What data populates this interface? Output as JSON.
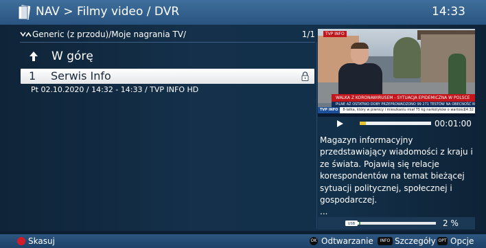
{
  "header": {
    "title": "NAV > Filmy video / DVR",
    "clock": "14:33",
    "icon": "folder-icon"
  },
  "list": {
    "path": "Generic (z przodu)/Moje nagrania TV/",
    "page": "1/1",
    "up_label": "W górę",
    "items": [
      {
        "number": "1",
        "name": "Serwis Info",
        "meta": "Pt 02.10.2020 / 14:32 - 14:33 / TVP INFO HD",
        "locked": true
      }
    ]
  },
  "preview": {
    "channel_tag": "TVP INFO",
    "banner": "WALKA Z KORONAWIRUSEM - SYTUACJA EPIDEMICZNA W POLSCE",
    "ticker_top": "PILNE   AŻ OSTATNIO DOBY PRZEPROWADZONO 99 271 TESTÓW NA OBECNOŚĆ KORONAWIRUSA",
    "ticker": "8-latka, który w piwnicy i mieszkaniu miał 75 kg narkotyków o wartości",
    "ticker_logo": "TVP INFO",
    "ticker_time": "14:32"
  },
  "playback": {
    "time": "00:01:00",
    "progress": 0.09,
    "progress_color": "#e8c330"
  },
  "description": "Magazyn informacyjny przedstawiający wiadomości z kraju i ze świata. Pojawią się relacje korespondentów na temat bieżącej sytuacji politycznej, społecznej i gospodarczej.\n...",
  "storage": {
    "device": "USB",
    "label": "2 %",
    "fraction": 0.02,
    "fill_color": "#3aa03a"
  },
  "footer": {
    "delete_label": "Skasuj",
    "ok_key": "OK",
    "play_label": "Odtwarzanie",
    "info_key": "INFO",
    "details_label": "Szczegóły",
    "opt_key": "OPT",
    "options_label": "Opcje"
  },
  "colors": {
    "accent": "#2a5380",
    "red_key": "#d21c2a"
  }
}
